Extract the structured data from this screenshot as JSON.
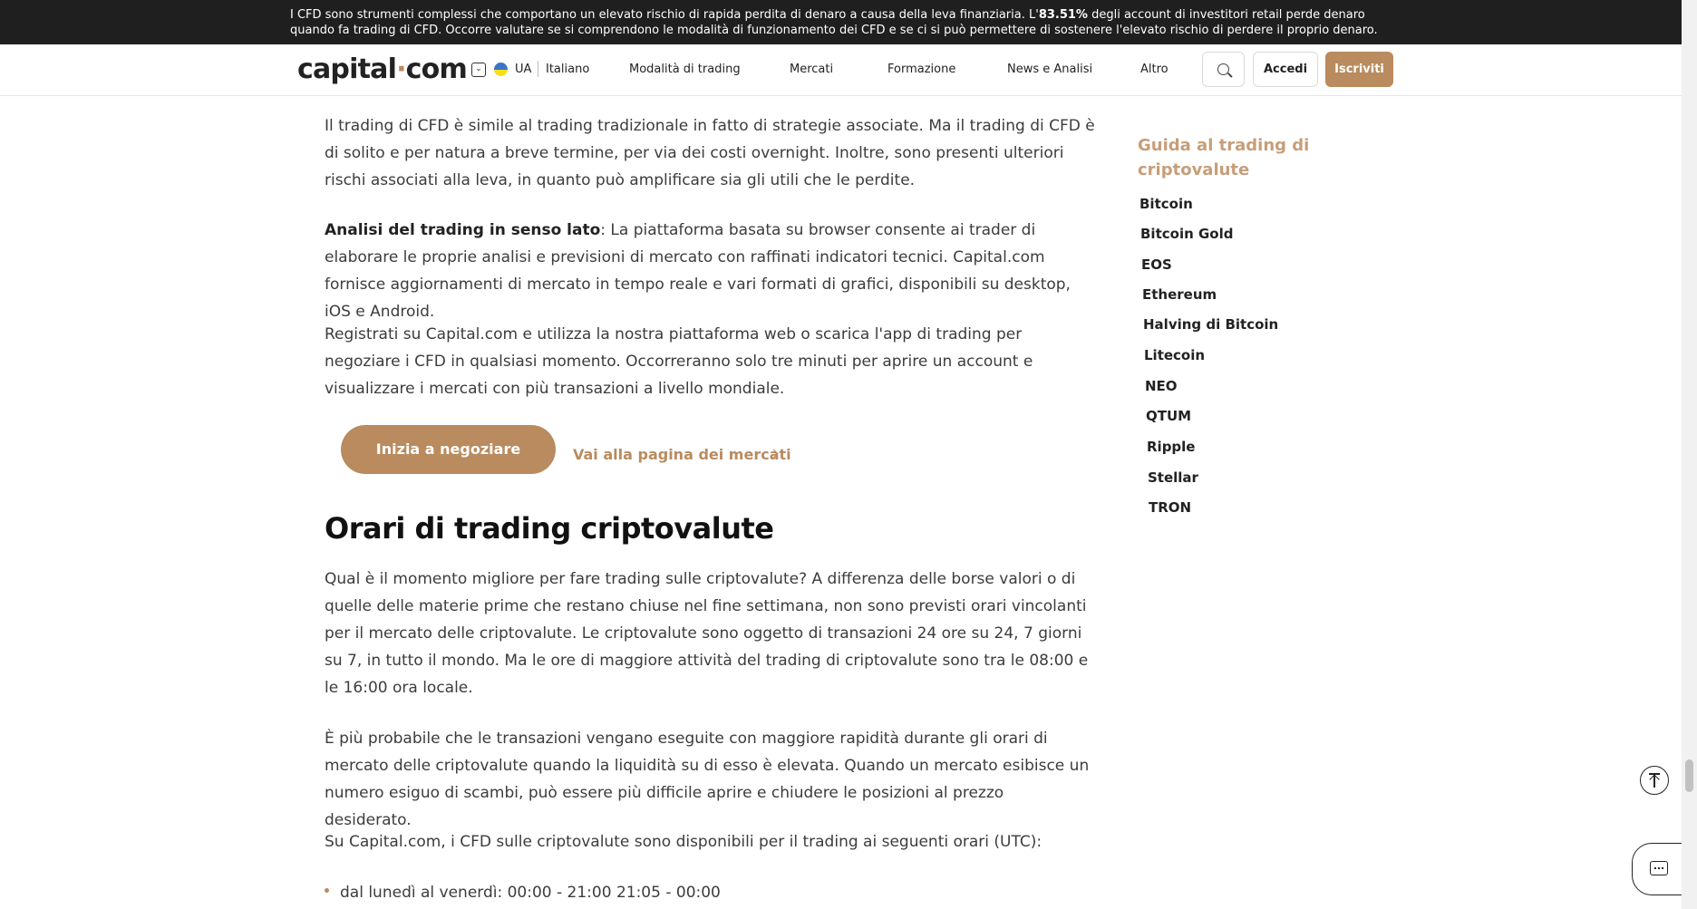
{
  "risk_banner": {
    "before": "I CFD sono strumenti complessi che comportano un elevato rischio di rapida perdita di denaro a causa della leva finanziaria. L'",
    "percent": "83.51%",
    "after": " degli account di investitori retail perde denaro quando fa trading di CFD. Occorre valutare se si comprendono le modalità di funzionamento dei CFD e se ci si può permettere di sostenere l'elevato rischio di perdere il proprio denaro."
  },
  "header": {
    "logo_left": "capital",
    "logo_dot": "·",
    "logo_right": "com",
    "region": "UA",
    "language": "Italiano",
    "nav": [
      "Modalità di trading",
      "Mercati",
      "Formazione",
      "News e Analisi",
      "Altro"
    ],
    "login_label": "Accedi",
    "signup_label": "Iscriviti"
  },
  "article": {
    "p1": "Il trading di CFD è simile al trading tradizionale in fatto di strategie associate. Ma il trading di CFD è di solito e per natura a breve termine, per via dei costi overnight. Inoltre, sono presenti ulteriori rischi associati alla leva, in quanto può amplificare sia gli utili che le perdite.",
    "p2_bold": "Analisi del trading in senso lato",
    "p2_rest": ": La piattaforma basata su browser consente ai trader di elaborare le proprie analisi e previsioni di mercato con raffinati indicatori tecnici. Capital.com fornisce aggiornamenti di mercato in tempo reale e vari formati di grafici, disponibili su desktop, iOS e Android.",
    "p3": "Registrati su Capital.com e utilizza la nostra piattaforma web o scarica l'app di trading per negoziare i CFD in qualsiasi momento. Occorreranno solo tre minuti per aprire un account e visualizzare i mercati con più transazioni a livello mondiale.",
    "cta_label": "Inizia a negoziare",
    "markets_link": "Vai alla pagina dei mercati",
    "heading": "Orari di trading criptovalute",
    "p4": "Qual è il momento migliore per fare trading sulle criptovalute? A differenza delle borse valori o di quelle delle materie prime che restano chiuse nel fine settimana, non sono previsti orari vincolanti per il mercato delle criptovalute. Le criptovalute sono oggetto di transazioni 24 ore su 24, 7 giorni su 7, in tutto il mondo. Ma le ore di maggiore attività del trading di criptovalute sono tra le 08:00 e le 16:00 ora locale.",
    "p5": "È più probabile che le transazioni vengano eseguite con maggiore rapidità durante gli orari di mercato delle criptovalute quando la liquidità su di esso è elevata. Quando un mercato esibisce un numero esiguo di scambi, può essere più difficile aprire e chiudere le posizioni al prezzo desiderato.",
    "p6": "Su Capital.com, i CFD sulle criptovalute sono disponibili per il trading ai seguenti orari (UTC):",
    "bullet1": "dal lunedì al venerdì: 00:00 - 21:00 21:05 - 00:00"
  },
  "sidebar": {
    "title": "Guida al trading di criptovalute",
    "items": [
      "Bitcoin",
      "Bitcoin Gold",
      "EOS",
      "Ethereum",
      "Halving di Bitcoin",
      "Litecoin",
      "NEO",
      "QTUM",
      "Ripple",
      "Stellar",
      "TRON"
    ]
  },
  "colors": {
    "accent": "#b98b5e",
    "banner_bg": "#1f1f1f"
  }
}
